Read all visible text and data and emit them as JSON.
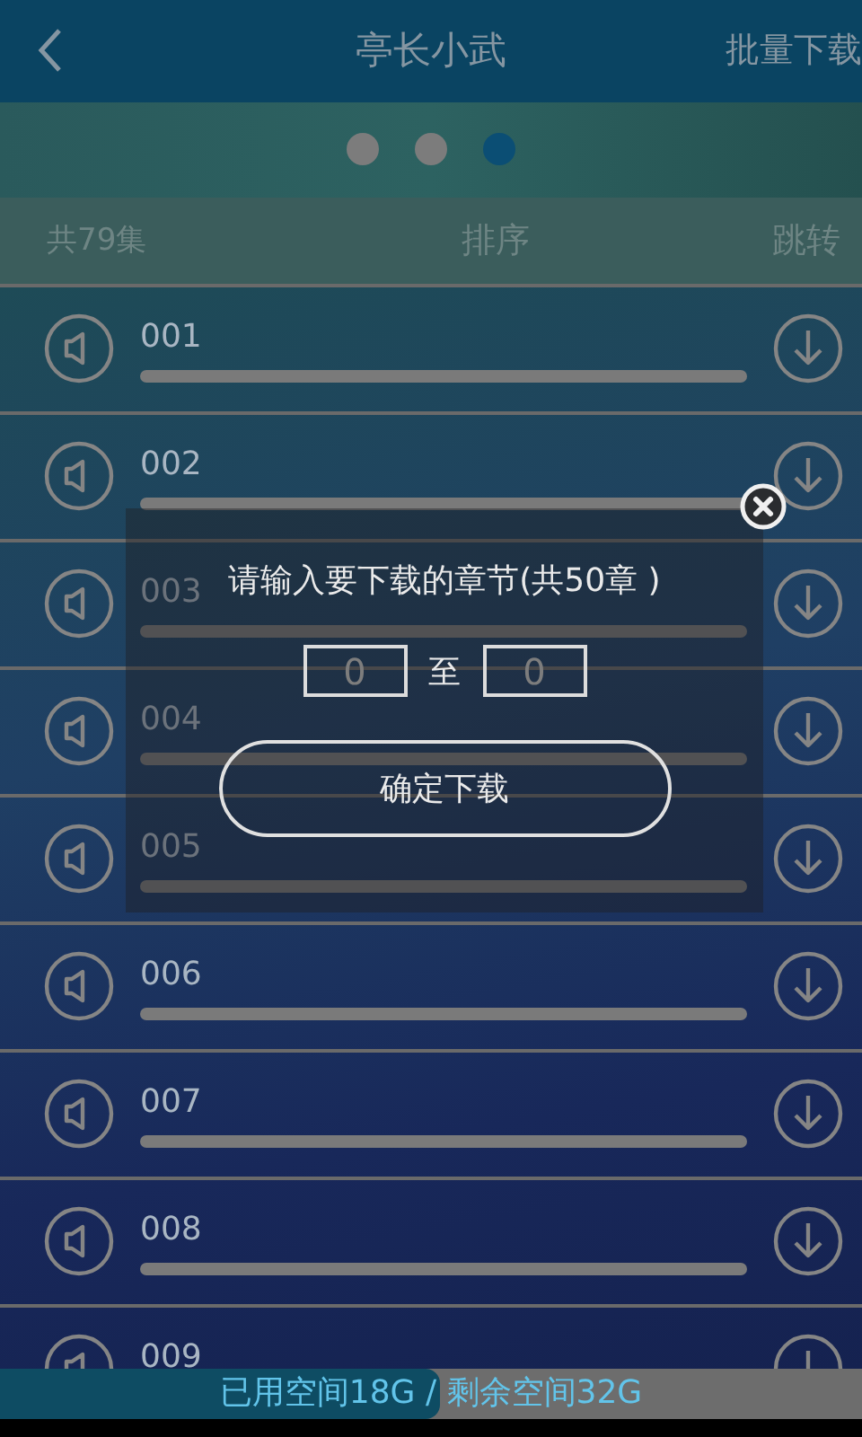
{
  "header": {
    "title": "亭长小武",
    "action": "批量下载"
  },
  "pager": {
    "dots": [
      {
        "selected": false
      },
      {
        "selected": false
      },
      {
        "selected": true
      }
    ]
  },
  "info_bar": {
    "count": "共79集",
    "sort": "排序",
    "jump": "跳转"
  },
  "episodes": [
    {
      "title": "001"
    },
    {
      "title": "002"
    },
    {
      "title": "003"
    },
    {
      "title": "004"
    },
    {
      "title": "005"
    },
    {
      "title": "006"
    },
    {
      "title": "007"
    },
    {
      "title": "008"
    },
    {
      "title": "009"
    }
  ],
  "storage": {
    "text": "已用空间18G / 剩余空间32G",
    "level": 0.51
  },
  "dialog": {
    "prompt": "请输入要下载的章节(共50章 )",
    "from": "0",
    "separator": "至",
    "to": "0",
    "confirm": "确定下载"
  }
}
